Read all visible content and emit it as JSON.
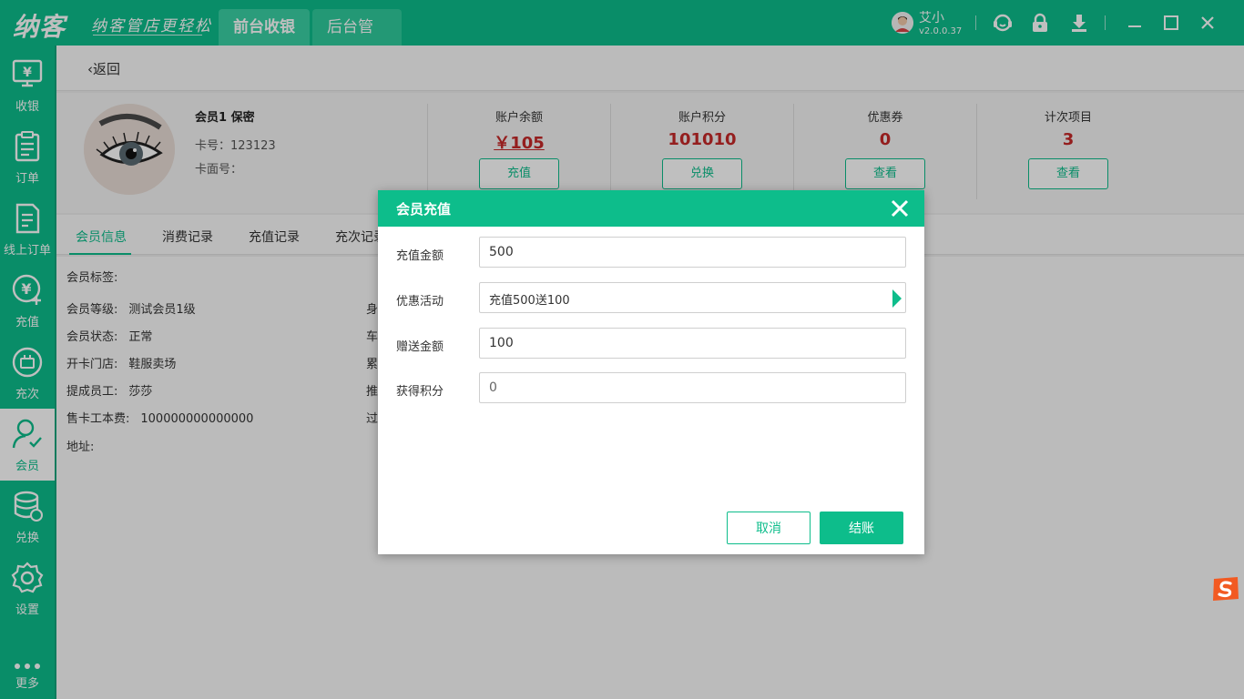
{
  "app": {
    "logo": "纳客",
    "slogan": "纳客管店更轻松",
    "nav_tabs": [
      {
        "label": "前台收银",
        "active": true
      },
      {
        "label": "后台管理",
        "active": false
      }
    ],
    "user": {
      "name": "艾小",
      "version": "v2.0.0.37"
    },
    "toolbar_icons": [
      "headset-icon",
      "lock-icon",
      "download-icon",
      "minimize-icon",
      "maximize-icon",
      "close-icon"
    ]
  },
  "sidebar": {
    "items": [
      {
        "label": "收银",
        "icon": "cashier-icon",
        "active": false
      },
      {
        "label": "订单",
        "icon": "order-icon",
        "active": false
      },
      {
        "label": "线上订单",
        "icon": "online-order-icon",
        "active": false
      },
      {
        "label": "充值",
        "icon": "recharge-icon",
        "active": false
      },
      {
        "label": "充次",
        "icon": "recharge-times-icon",
        "active": false
      },
      {
        "label": "会员",
        "icon": "member-icon",
        "active": true
      },
      {
        "label": "兑换",
        "icon": "exchange-icon",
        "active": false
      },
      {
        "label": "设置",
        "icon": "settings-icon",
        "active": false
      },
      {
        "label": "更多",
        "icon": "more-icon",
        "active": false
      }
    ]
  },
  "back": {
    "label": "返回"
  },
  "member": {
    "name": "会员1 保密",
    "card_no": "卡号：123123",
    "card_face": "卡面号："
  },
  "stats": [
    {
      "title": "账户余额",
      "value": "￥105",
      "button": "充值"
    },
    {
      "title": "账户积分",
      "value": "101010",
      "button": "兑换"
    },
    {
      "title": "优惠券",
      "value": "0",
      "button": "查看"
    },
    {
      "title": "计次项目",
      "value": "3",
      "button": "查看"
    }
  ],
  "tabs": [
    "会员信息",
    "消费记录",
    "充值记录",
    "充次记录"
  ],
  "info": {
    "tag_label": "会员标签:",
    "rows": [
      {
        "label": "会员等级:",
        "value": "测试会员1级",
        "right": "身"
      },
      {
        "label": "会员状态:",
        "value": "正常",
        "right": "车"
      },
      {
        "label": "开卡门店:",
        "value": "鞋服卖场",
        "right": "累"
      },
      {
        "label": "提成员工:",
        "value": "莎莎",
        "right": "推"
      },
      {
        "label": "售卡工本费:",
        "value": "100000000000000",
        "right": "过"
      }
    ],
    "address_label": "地址:"
  },
  "dialog": {
    "title": "会员充值",
    "fields": {
      "amount": {
        "label": "充值金额",
        "value": "500"
      },
      "promotion": {
        "label": "优惠活动",
        "value": "充值500送100"
      },
      "bonus": {
        "label": "赠送金额",
        "value": "100"
      },
      "points": {
        "label": "获得积分",
        "value": "0"
      }
    },
    "cancel": "取消",
    "confirm": "结账"
  },
  "colors": {
    "primary": "#0dbd8b",
    "value_red": "#c62828"
  }
}
